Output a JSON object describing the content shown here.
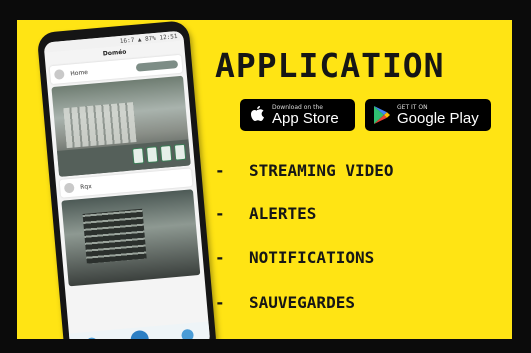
{
  "phone": {
    "app_title": "Doméo",
    "status_text": "16:7 ▲ 87% 12:51",
    "cameras": [
      {
        "name": "Home"
      },
      {
        "name": "Rqx"
      }
    ]
  },
  "heading": "APPLICATION",
  "stores": {
    "apple": {
      "small": "Download on the",
      "big": "App Store"
    },
    "google": {
      "small": "GET IT ON",
      "big": "Google Play"
    }
  },
  "features": [
    {
      "dash": "-",
      "label": "STREAMING VIDEO"
    },
    {
      "dash": "-",
      "label": "ALERTES"
    },
    {
      "dash": "-",
      "label": "NOTIFICATIONS"
    },
    {
      "dash": "-",
      "label": "SAUVEGARDES"
    }
  ],
  "colors": {
    "banner": "#ffe414",
    "text": "#161616",
    "frame": "#0b0b0b"
  },
  "icons": [
    "apple-icon",
    "google-play-icon"
  ]
}
